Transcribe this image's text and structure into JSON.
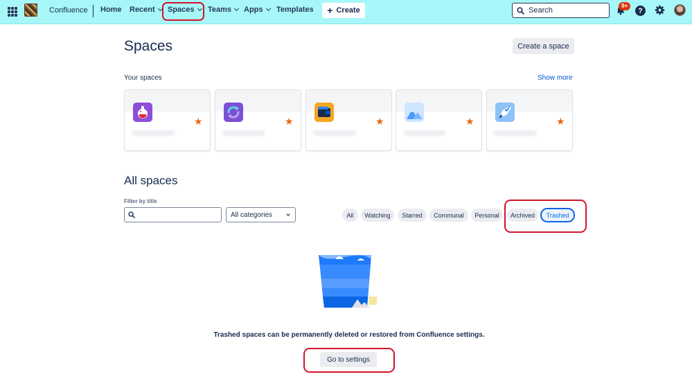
{
  "topnav": {
    "product_name": "Confluence",
    "items": [
      {
        "label": "Home",
        "has_chevron": false
      },
      {
        "label": "Recent",
        "has_chevron": true
      },
      {
        "label": "Spaces",
        "has_chevron": true
      },
      {
        "label": "Teams",
        "has_chevron": true
      },
      {
        "label": "Apps",
        "has_chevron": true
      },
      {
        "label": "Templates",
        "has_chevron": false
      }
    ],
    "create_label": "Create",
    "search_placeholder": "Search",
    "notifications_badge": "9+",
    "help_glyph": "?",
    "icons": [
      "app-switcher-icon",
      "site-logo",
      "plus-icon",
      "search-icon",
      "bell-icon",
      "help-icon",
      "gear-icon",
      "avatar"
    ]
  },
  "main": {
    "title": "Spaces",
    "create_space_label": "Create a space",
    "your_spaces_heading": "Your spaces",
    "show_more_label": "Show more",
    "your_spaces": [
      {
        "icon": "potion-icon",
        "color": "#8e4ed8",
        "starred": true
      },
      {
        "icon": "refresh-icon",
        "color": "#7d4fd6",
        "starred": true
      },
      {
        "icon": "wallet-icon",
        "color": "#f5a623",
        "starred": true
      },
      {
        "icon": "mountain-icon",
        "color": "#6cb2f0",
        "starred": true
      },
      {
        "icon": "rocket-icon",
        "color": "#4c9df0",
        "starred": true
      }
    ],
    "all_spaces_heading": "All spaces",
    "filter_label": "Filter by title",
    "filter_value": "",
    "category_value": "All categories",
    "filter_pills": [
      "All",
      "Watching",
      "Starred",
      "Communal",
      "Personal",
      "Archived",
      "Trashed"
    ],
    "selected_pill": "Trashed",
    "empty_state_message": "Trashed spaces can be permanently deleted or restored from Confluence settings.",
    "go_to_settings_label": "Go to settings"
  },
  "colors": {
    "topnav_bg": "#a7f7f9",
    "highlight_red": "#d3132a",
    "link_blue": "#0052cc",
    "star_orange": "#e56910"
  }
}
